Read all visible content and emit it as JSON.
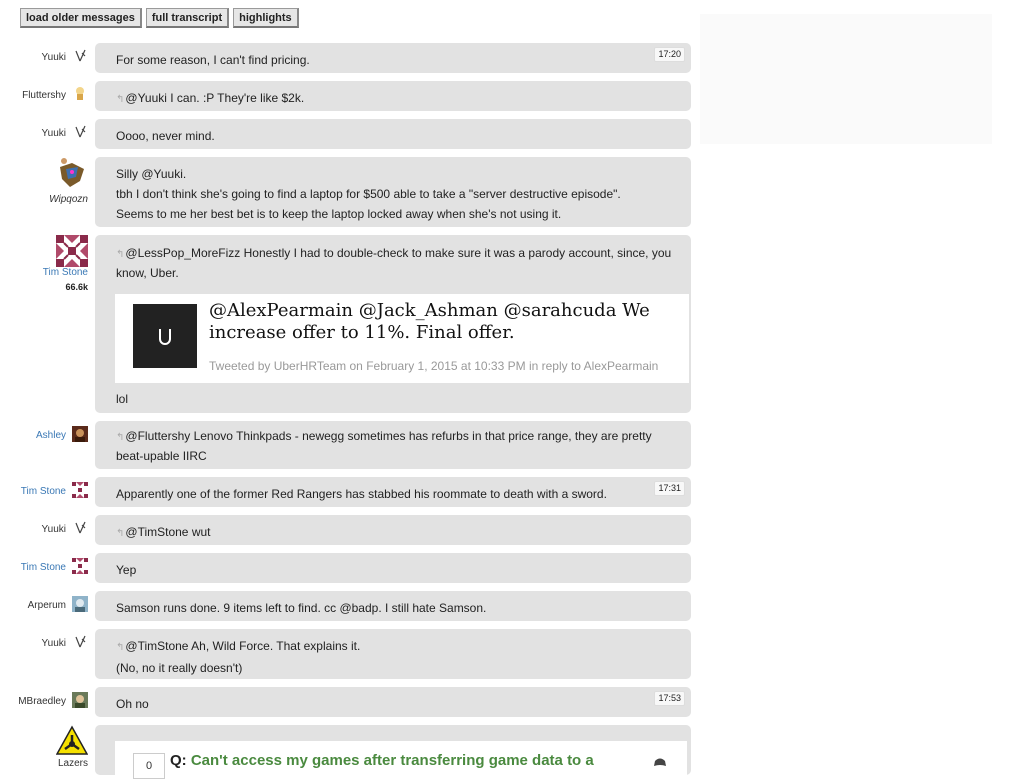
{
  "toolbar": {
    "load_older": "load older messages",
    "full_transcript": "full transcript",
    "highlights": "highlights"
  },
  "colors": {
    "bubble": "#e2e2e2",
    "link_blue": "#3a78b5",
    "question_green": "#4a8a3f"
  },
  "messages": [
    {
      "user": "Yuuki",
      "time": "17:20",
      "lines": [
        "For some reason, I can't find pricing."
      ]
    },
    {
      "user": "Fluttershy",
      "reply": true,
      "lines": [
        "@Yuuki I can. :P They're like $2k."
      ]
    },
    {
      "user": "Yuuki",
      "lines": [
        "Oooo, never mind."
      ]
    },
    {
      "user": "Wipqozn",
      "lines": [
        "Silly @Yuuki.",
        "tbh I don't think she's going to find a laptop for $500 able to take a \"server destructive episode\".",
        "Seems to me her best bet is to keep the laptop locked away when she's not using it."
      ]
    },
    {
      "user": "Tim Stone",
      "rep": "66.6k",
      "reply": true,
      "lines": [
        "@LessPop_MoreFizz Honestly I had to double-check to make sure it was a parody account, since, you know, Uber."
      ],
      "tweet": {
        "text": "@AlexPearmain @Jack_Ashman @sarahcuda We increase offer to 11%. Final offer.",
        "meta": "Tweeted by UberHRTeam on February 1, 2015 at 10:33 PM in reply to AlexPearmain"
      },
      "after": "lol"
    },
    {
      "user": "Ashley",
      "reply": true,
      "lines": [
        "@Fluttershy Lenovo Thinkpads - newegg sometimes has refurbs in that price range, they are pretty beat-upable IIRC"
      ]
    },
    {
      "user": "Tim Stone",
      "time": "17:31",
      "lines": [
        "Apparently one of the former Red Rangers has stabbed his roommate to death with a sword."
      ]
    },
    {
      "user": "Yuuki",
      "reply": true,
      "lines": [
        "@TimStone wut"
      ]
    },
    {
      "user": "Tim Stone",
      "lines": [
        "Yep"
      ]
    },
    {
      "user": "Arperum",
      "lines": [
        "Samson runs done. 9 items left to find. cc @badp. I still hate Samson."
      ]
    },
    {
      "user": "Yuuki",
      "reply": true,
      "lines": [
        "@TimStone Ah, Wild Force. That explains it.",
        "(No, no it really doesn't)"
      ]
    },
    {
      "user": "MBraedley",
      "time": "17:53",
      "lines": [
        "Oh no"
      ]
    },
    {
      "user": "Lazers",
      "question": {
        "votes": "0",
        "prefix": "Q:",
        "title": "Can't access my games after transferring game data to a"
      }
    }
  ]
}
